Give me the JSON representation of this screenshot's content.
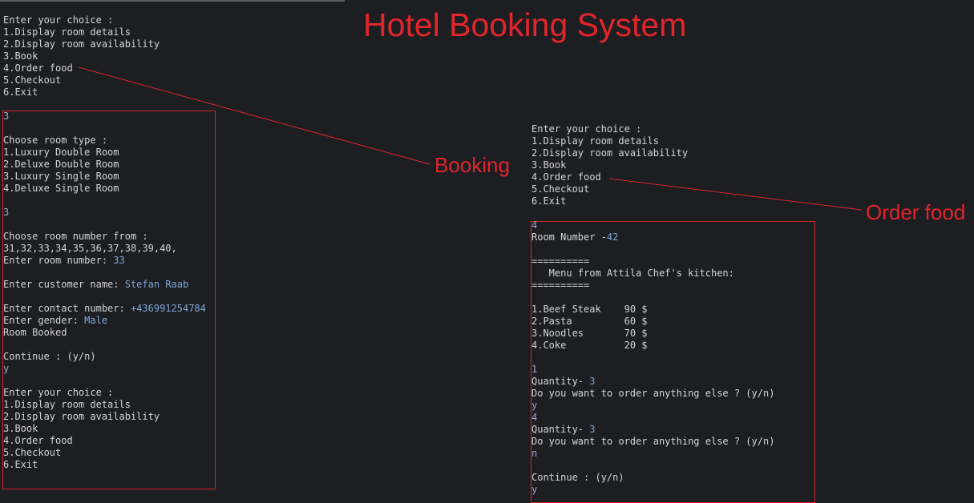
{
  "title": "Hotel Booking System",
  "annotations": {
    "booking": "Booking",
    "order_food": "Order food"
  },
  "colors": {
    "background": "#1c1e21",
    "text": "#d4d4d4",
    "accent_red": "#e0252c",
    "input_blue": "#9aa7c8"
  },
  "left_console": {
    "menu": [
      "Enter your choice :",
      "1.Display room details",
      "2.Display room availability",
      "3.Book",
      "4.Order food",
      "5.Checkout",
      "6.Exit"
    ],
    "session": [
      {
        "text": "3",
        "type": "input"
      },
      {
        "text": "",
        "type": "text"
      },
      {
        "text": "Choose room type :",
        "type": "text"
      },
      {
        "text": "1.Luxury Double Room",
        "type": "text"
      },
      {
        "text": "2.Deluxe Double Room",
        "type": "text"
      },
      {
        "text": "3.Luxury Single Room",
        "type": "text"
      },
      {
        "text": "4.Deluxe Single Room",
        "type": "text"
      },
      {
        "text": "",
        "type": "text"
      },
      {
        "text": "3",
        "type": "input"
      },
      {
        "text": "",
        "type": "text"
      },
      {
        "text": "Choose room number from :",
        "type": "text"
      },
      {
        "text": "31,32,33,34,35,36,37,38,39,40,",
        "type": "text"
      },
      {
        "prompt": "Enter room number: ",
        "value": "33",
        "type": "prompt"
      },
      {
        "text": "",
        "type": "text"
      },
      {
        "prompt": "Enter customer name: ",
        "value": "Stefan Raab",
        "type": "prompt"
      },
      {
        "text": "",
        "type": "text"
      },
      {
        "prompt": "Enter contact number: ",
        "value": "+436991254784",
        "type": "prompt"
      },
      {
        "prompt": "Enter gender: ",
        "value": "Male",
        "type": "prompt"
      },
      {
        "text": "Room Booked",
        "type": "text"
      },
      {
        "text": "",
        "type": "text"
      },
      {
        "text": "Continue : (y/n)",
        "type": "text"
      },
      {
        "text": "y",
        "type": "input"
      },
      {
        "text": "",
        "type": "text"
      },
      {
        "text": "Enter your choice :",
        "type": "text"
      },
      {
        "text": "1.Display room details",
        "type": "text"
      },
      {
        "text": "2.Display room availability",
        "type": "text"
      },
      {
        "text": "3.Book",
        "type": "text"
      },
      {
        "text": "4.Order food",
        "type": "text"
      },
      {
        "text": "5.Checkout",
        "type": "text"
      },
      {
        "text": "6.Exit",
        "type": "text"
      }
    ]
  },
  "right_console": {
    "menu": [
      "Enter your choice :",
      "1.Display room details",
      "2.Display room availability",
      "3.Book",
      "4.Order food",
      "5.Checkout",
      "6.Exit"
    ],
    "session": [
      {
        "text": "4",
        "type": "input"
      },
      {
        "prompt": "Room Number -",
        "value": "42",
        "type": "prompt"
      },
      {
        "text": "",
        "type": "text"
      },
      {
        "text": "==========",
        "type": "text"
      },
      {
        "text": "   Menu from Attila Chef's kitchen:",
        "type": "text"
      },
      {
        "text": "==========",
        "type": "text"
      },
      {
        "text": "",
        "type": "text"
      },
      {
        "text": "1.Beef Steak    90 $",
        "type": "text"
      },
      {
        "text": "2.Pasta         60 $",
        "type": "text"
      },
      {
        "text": "3.Noodles       70 $",
        "type": "text"
      },
      {
        "text": "4.Coke          20 $",
        "type": "text"
      },
      {
        "text": "",
        "type": "text"
      },
      {
        "text": "1",
        "type": "input"
      },
      {
        "prompt": "Quantity- ",
        "value": "3",
        "type": "prompt"
      },
      {
        "text": "Do you want to order anything else ? (y/n)",
        "type": "text"
      },
      {
        "text": "y",
        "type": "input"
      },
      {
        "text": "4",
        "type": "input"
      },
      {
        "prompt": "Quantity- ",
        "value": "3",
        "type": "prompt"
      },
      {
        "text": "Do you want to order anything else ? (y/n)",
        "type": "text"
      },
      {
        "text": "n",
        "type": "input"
      },
      {
        "text": "",
        "type": "text"
      },
      {
        "text": "Continue : (y/n)",
        "type": "text"
      },
      {
        "text": "y",
        "type": "input"
      }
    ]
  }
}
